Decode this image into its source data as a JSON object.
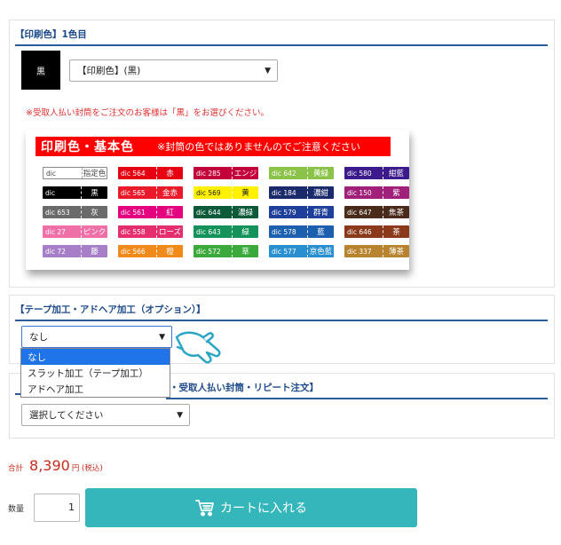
{
  "print_color": {
    "title": "【印刷色】1色目",
    "swatch_label": "黒",
    "select_value": "【印刷色】(黒)",
    "notice": "※受取人払い封筒をご注文のお客様は「黒」をお選びください。"
  },
  "color_chart": {
    "header_main": "印刷色・基本色",
    "header_note": "※封筒の色ではありませんのでご注意ください",
    "chips": [
      {
        "code": "dic",
        "name": "指定色",
        "color": "#ffffff",
        "plain": true
      },
      {
        "code": "dic 564",
        "name": "赤",
        "color": "#e60012"
      },
      {
        "code": "dic 285",
        "name": "エンジ",
        "color": "#c4003a"
      },
      {
        "code": "dic 642",
        "name": "黄緑",
        "color": "#8bc34a"
      },
      {
        "code": "dic 580",
        "name": "紺藍",
        "color": "#3c1a8c"
      },
      {
        "code": "dic",
        "name": "黒",
        "color": "#000000"
      },
      {
        "code": "dic 565",
        "name": "金赤",
        "color": "#ea1a2a"
      },
      {
        "code": "dic 569",
        "name": "黄",
        "color": "#fff100",
        "dark": true
      },
      {
        "code": "dic 184",
        "name": "濃紺",
        "color": "#1b2a6b"
      },
      {
        "code": "dic 150",
        "name": "紫",
        "color": "#a0207a"
      },
      {
        "code": "dic 653",
        "name": "灰",
        "color": "#6b6b6b"
      },
      {
        "code": "dic 561",
        "name": "紅",
        "color": "#e4007f"
      },
      {
        "code": "dic 644",
        "name": "濃緑",
        "color": "#0d5a3a"
      },
      {
        "code": "dic 579",
        "name": "群青",
        "color": "#1e3f9a"
      },
      {
        "code": "dic 647",
        "name": "焦茶",
        "color": "#4a2a1a"
      },
      {
        "code": "dic 27",
        "name": "ピンク",
        "color": "#ef6fa7"
      },
      {
        "code": "dic 558",
        "name": "ローズ",
        "color": "#e62e6e"
      },
      {
        "code": "dic 643",
        "name": "緑",
        "color": "#13935a"
      },
      {
        "code": "dic 578",
        "name": "藍",
        "color": "#1c5fae"
      },
      {
        "code": "dic 646",
        "name": "茶",
        "color": "#8a3a1a"
      },
      {
        "code": "dic 72",
        "name": "藤",
        "color": "#a67fc8"
      },
      {
        "code": "dic 566",
        "name": "橙",
        "color": "#f08a1a"
      },
      {
        "code": "dic 572",
        "name": "草",
        "color": "#3ca93c"
      },
      {
        "code": "dic 577",
        "name": "京色藍",
        "color": "#2a8fd0"
      },
      {
        "code": "dic 337",
        "name": "薄茶",
        "color": "#b7832e"
      }
    ]
  },
  "tape": {
    "title": "【テープ加工・アドヘア加工（オプション）】",
    "select_value": "なし",
    "options": [
      "なし",
      "スラット加工（テープ加工）",
      "アドヘア加工"
    ]
  },
  "envelope": {
    "title": "・受取人払い封筒・リピート注文】",
    "select_value": "選択してください"
  },
  "price": {
    "label": "合計",
    "amount": "8,390",
    "unit": "円 (税込)"
  },
  "quantity": {
    "label": "数量",
    "value": "1"
  },
  "cart": {
    "label": "カートに入れる"
  },
  "icons": {
    "arrow": "chevron-down-icon",
    "hand": "pointing-hand-icon",
    "cart": "cart-icon"
  }
}
